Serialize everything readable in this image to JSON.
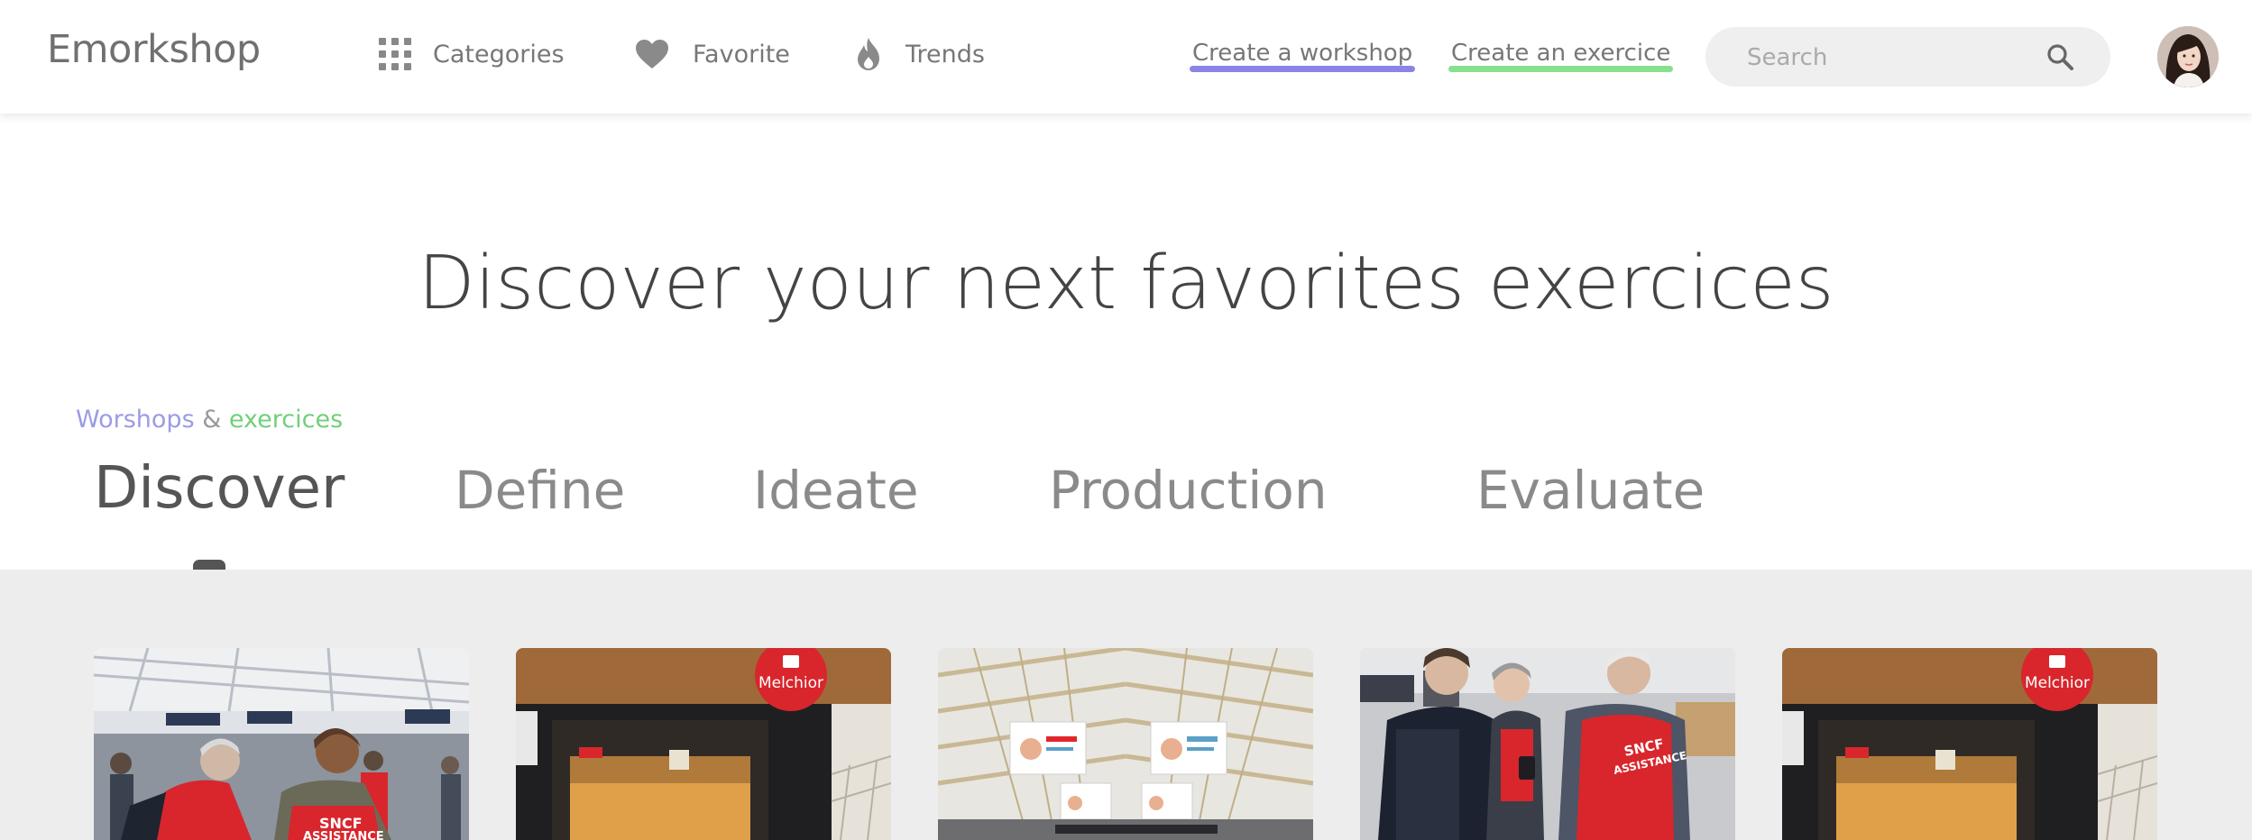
{
  "app": {
    "logo": "Emorkshop"
  },
  "nav": {
    "categories": {
      "label": "Categories",
      "icon": "grid-icon"
    },
    "favorite": {
      "label": "Favorite",
      "icon": "heart-icon"
    },
    "trends": {
      "label": "Trends",
      "icon": "flame-icon"
    }
  },
  "actions": {
    "create_workshop": {
      "label": "Create a workshop",
      "underline_color": "#8b84e6"
    },
    "create_exercice": {
      "label": "Create an exercice",
      "underline_color": "#86e08e"
    }
  },
  "search": {
    "placeholder": "Search",
    "value": "",
    "icon": "search-icon"
  },
  "user": {
    "avatar": "avatar"
  },
  "hero": {
    "title": "Discover your next favorites exercices"
  },
  "kicker": {
    "workshops": "Worshops",
    "amp": "&",
    "exercices": "exercices"
  },
  "tabs": [
    {
      "label": "Discover",
      "active": true
    },
    {
      "label": "Define",
      "active": false
    },
    {
      "label": "Ideate",
      "active": false
    },
    {
      "label": "Production",
      "active": false
    },
    {
      "label": "Evaluate",
      "active": false
    }
  ],
  "cards": [
    {
      "image": "SNCF assistance staff in red vests in a train station",
      "logo_text": ""
    },
    {
      "image": "Melchior vending kiosk",
      "logo_text": "Melchior"
    },
    {
      "image": "Station hall with hanging screens",
      "logo_text": ""
    },
    {
      "image": "SNCF assistance agent helping traveler",
      "logo_text": "SNCF ASSISTANCE"
    },
    {
      "image": "Melchior vending kiosk",
      "logo_text": "Melchior"
    }
  ],
  "colors": {
    "accent_purple": "#8b84e6",
    "accent_green": "#86e08e",
    "band_bg": "#ededed",
    "sncf_red": "#e0262c"
  }
}
